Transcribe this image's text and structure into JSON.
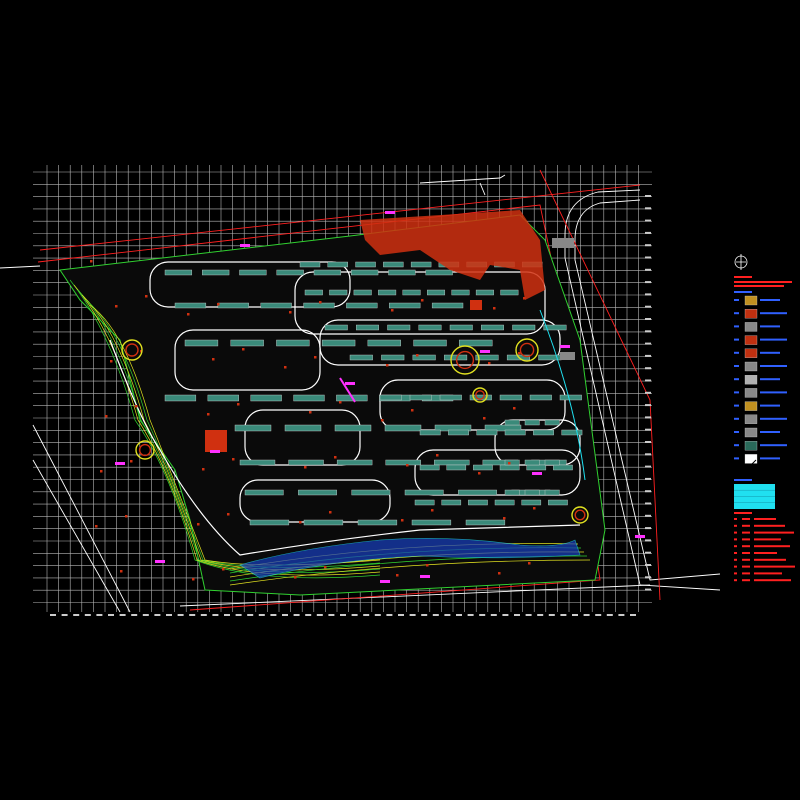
{
  "drawing": {
    "colors": {
      "background": "#000000",
      "grid": "#d8d8d8",
      "boundary": "#ff2020",
      "road": "#ffffff",
      "contour_green": "#30d030",
      "contour_yellow": "#e0e020",
      "building": "#3a8a7a",
      "plaza": "#d03010",
      "water": "#1840c0",
      "magenta": "#ff30ff",
      "cyan": "#20e0f0",
      "legend_blue": "#3060ff",
      "legend_red": "#ff2020"
    },
    "north_arrow_icon": "north-arrow-icon",
    "legend": {
      "title": "",
      "swatch_colors": [
        "#c09020",
        "#c03010",
        "#888888",
        "#c03010",
        "#c03010",
        "#888888",
        "#b0b0b0",
        "#888888",
        "#c09020",
        "#888888",
        "#888888",
        "#2a6a5a",
        "#ffffff"
      ]
    },
    "notes_table_color": "#20e0f0",
    "notes_count": 7
  }
}
